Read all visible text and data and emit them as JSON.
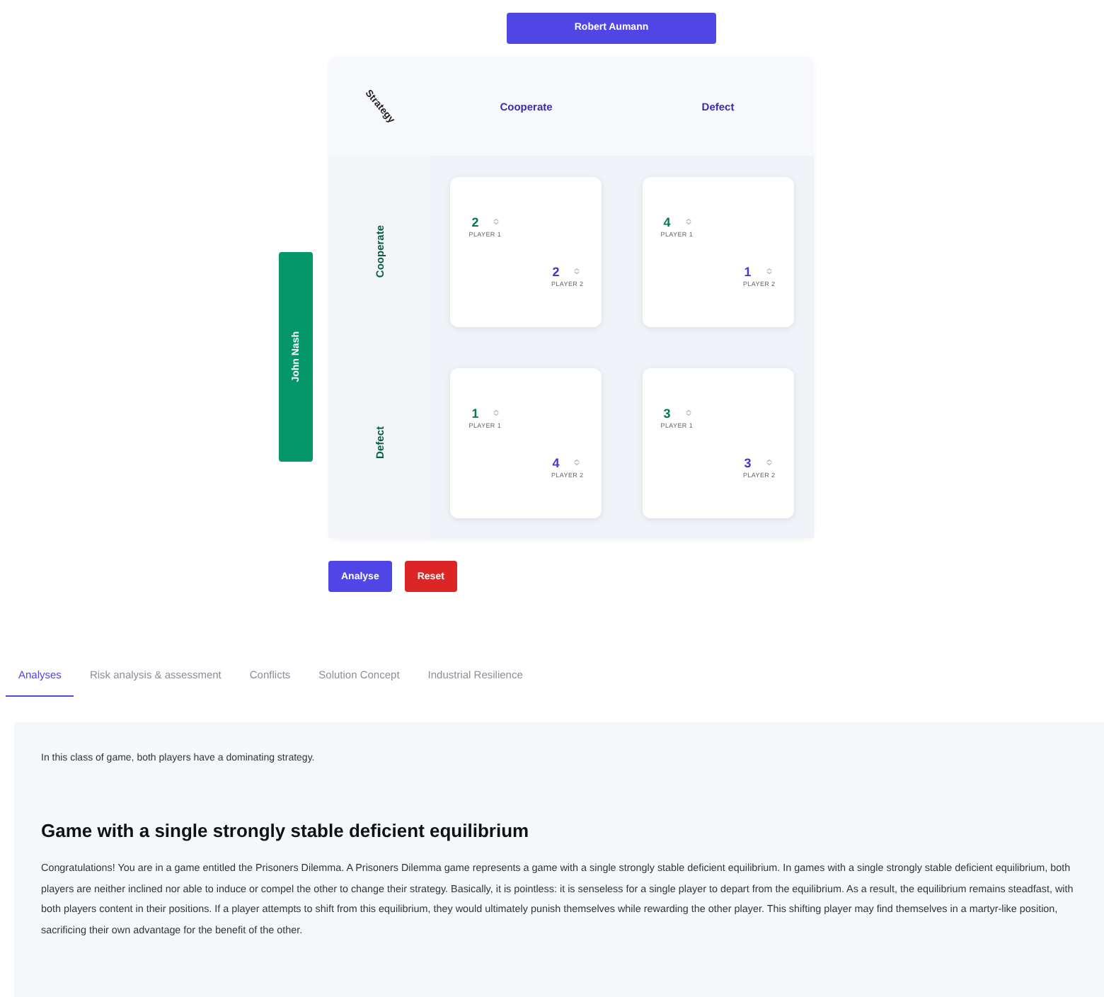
{
  "column_player": {
    "label": "Robert Aumann"
  },
  "row_player": {
    "label": "John Nash"
  },
  "matrix": {
    "corner_label": "Strategy",
    "columns": [
      "Cooperate",
      "Defect"
    ],
    "rows": [
      {
        "label": "Cooperate",
        "cells": [
          {
            "player1": {
              "value": "2",
              "label": "PLAYER 1"
            },
            "player2": {
              "value": "2",
              "label": "PLAYER 2"
            }
          },
          {
            "player1": {
              "value": "4",
              "label": "PLAYER 1"
            },
            "player2": {
              "value": "1",
              "label": "PLAYER 2"
            }
          }
        ]
      },
      {
        "label": "Defect",
        "cells": [
          {
            "player1": {
              "value": "1",
              "label": "PLAYER 1"
            },
            "player2": {
              "value": "4",
              "label": "PLAYER 2"
            }
          },
          {
            "player1": {
              "value": "3",
              "label": "PLAYER 1"
            },
            "player2": {
              "value": "3",
              "label": "PLAYER 2"
            }
          }
        ]
      }
    ]
  },
  "actions": [
    {
      "label": "Analyse",
      "kind": "primary"
    },
    {
      "label": "Reset",
      "kind": "danger"
    }
  ],
  "tabs": [
    {
      "label": "Analyses",
      "selected": true
    },
    {
      "label": "Risk analysis & assessment",
      "selected": false
    },
    {
      "label": "Conflicts",
      "selected": false
    },
    {
      "label": "Solution Concept",
      "selected": false
    },
    {
      "label": "Industrial Resilience",
      "selected": false
    }
  ],
  "analysis": {
    "intro": "In this class of game, both players have a dominating strategy.",
    "heading": "Game with a single strongly stable deficient equilibrium",
    "body": "Congratulations! You are in a game entitled the Prisoners Dilemma. A Prisoners Dilemma game represents a game with a single strongly stable deficient equilibrium. In games with a single strongly stable deficient equilibrium, both players are neither inclined nor able to induce or compel the other to change their strategy. Basically, it is pointless: it is senseless for a single player to depart from the equilibrium. As a result, the equilibrium remains steadfast, with both players content in their positions. If a player attempts to shift from this equilibrium, they would ultimately punish themselves while rewarding the other player. This shifting player may find themselves in a martyr-like position, sacrificing their own advantage for the benefit of the other."
  }
}
